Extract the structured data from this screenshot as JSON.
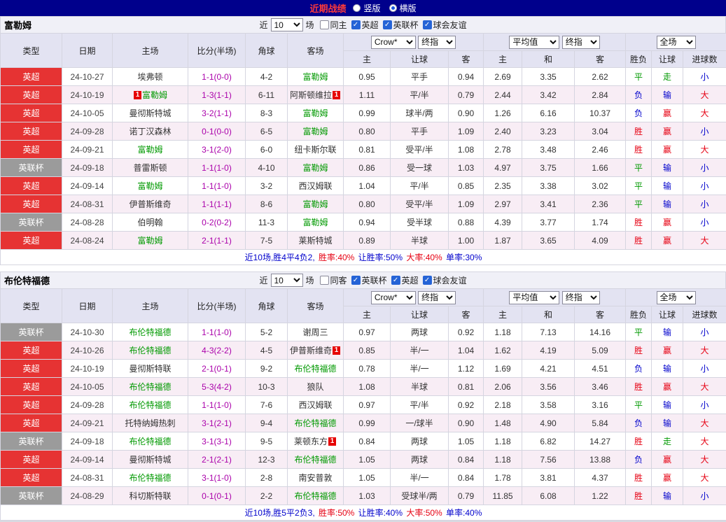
{
  "topbar": {
    "title": "近期战绩",
    "vertical": "竖版",
    "horizontal": "横版"
  },
  "controls": {
    "near": "近",
    "count": "10",
    "games": "场",
    "crow": "Crow*",
    "final": "终指",
    "avg": "平均值",
    "scope": "全场"
  },
  "columns": {
    "main": [
      "类型",
      "日期",
      "主场",
      "比分(半场)",
      "角球",
      "客场"
    ],
    "sub": [
      "主",
      "让球",
      "客",
      "主",
      "和",
      "客",
      "胜负",
      "让球",
      "进球数"
    ]
  },
  "colors": {
    "red": "#e60012",
    "blue": "#0000cc"
  },
  "type_colors": {
    "英超": "#e63333",
    "英联杯": "#9b9b9b"
  },
  "result_colors": {
    "胜": "#e60012",
    "赢": "#e60012",
    "大": "#e60012",
    "平": "#009900",
    "走": "#009900",
    "负": "#0000cc",
    "输": "#0000cc",
    "小": "#0000cc"
  },
  "sections": [
    {
      "team": "富勒姆",
      "filters": [
        {
          "label": "同主",
          "checked": false
        },
        {
          "label": "英超",
          "checked": true
        },
        {
          "label": "英联杯",
          "checked": true
        },
        {
          "label": "球会友谊",
          "checked": true
        }
      ],
      "rows": [
        {
          "type": "英超",
          "date": "24-10-27",
          "home": "埃弗顿",
          "hf": false,
          "hb": "",
          "score": "1-1(0-0)",
          "corner": "4-2",
          "away": "富勒姆",
          "af": true,
          "ab": "",
          "asia": [
            "0.95",
            "平手",
            "0.94"
          ],
          "euro": [
            "2.69",
            "3.35",
            "2.62"
          ],
          "res": [
            "平",
            "走",
            "小"
          ]
        },
        {
          "type": "英超",
          "date": "24-10-19",
          "home": "富勒姆",
          "hf": true,
          "hb": "1",
          "score": "1-3(1-1)",
          "corner": "6-11",
          "away": "阿斯顿维拉",
          "af": false,
          "ab": "1",
          "asia": [
            "1.11",
            "平/半",
            "0.79"
          ],
          "euro": [
            "2.44",
            "3.42",
            "2.84"
          ],
          "res": [
            "负",
            "输",
            "大"
          ]
        },
        {
          "type": "英超",
          "date": "24-10-05",
          "home": "曼彻斯特城",
          "hf": false,
          "hb": "",
          "score": "3-2(1-1)",
          "corner": "8-3",
          "away": "富勒姆",
          "af": true,
          "ab": "",
          "asia": [
            "0.99",
            "球半/两",
            "0.90"
          ],
          "euro": [
            "1.26",
            "6.16",
            "10.37"
          ],
          "res": [
            "负",
            "赢",
            "大"
          ]
        },
        {
          "type": "英超",
          "date": "24-09-28",
          "home": "诺丁汉森林",
          "hf": false,
          "hb": "",
          "score": "0-1(0-0)",
          "corner": "6-5",
          "away": "富勒姆",
          "af": true,
          "ab": "",
          "asia": [
            "0.80",
            "平手",
            "1.09"
          ],
          "euro": [
            "2.40",
            "3.23",
            "3.04"
          ],
          "res": [
            "胜",
            "赢",
            "小"
          ]
        },
        {
          "type": "英超",
          "date": "24-09-21",
          "home": "富勒姆",
          "hf": true,
          "hb": "",
          "score": "3-1(2-0)",
          "corner": "6-0",
          "away": "纽卡斯尔联",
          "af": false,
          "ab": "",
          "asia": [
            "0.81",
            "受平/半",
            "1.08"
          ],
          "euro": [
            "2.78",
            "3.48",
            "2.46"
          ],
          "res": [
            "胜",
            "赢",
            "大"
          ]
        },
        {
          "type": "英联杯",
          "date": "24-09-18",
          "home": "普雷斯顿",
          "hf": false,
          "hb": "",
          "score": "1-1(1-0)",
          "corner": "4-10",
          "away": "富勒姆",
          "af": true,
          "ab": "",
          "asia": [
            "0.86",
            "受一球",
            "1.03"
          ],
          "euro": [
            "4.97",
            "3.75",
            "1.66"
          ],
          "res": [
            "平",
            "输",
            "小"
          ]
        },
        {
          "type": "英超",
          "date": "24-09-14",
          "home": "富勒姆",
          "hf": true,
          "hb": "",
          "score": "1-1(1-0)",
          "corner": "3-2",
          "away": "西汉姆联",
          "af": false,
          "ab": "",
          "asia": [
            "1.04",
            "平/半",
            "0.85"
          ],
          "euro": [
            "2.35",
            "3.38",
            "3.02"
          ],
          "res": [
            "平",
            "输",
            "小"
          ]
        },
        {
          "type": "英超",
          "date": "24-08-31",
          "home": "伊普斯维奇",
          "hf": false,
          "hb": "",
          "score": "1-1(1-1)",
          "corner": "8-6",
          "away": "富勒姆",
          "af": true,
          "ab": "",
          "asia": [
            "0.80",
            "受平/半",
            "1.09"
          ],
          "euro": [
            "2.97",
            "3.41",
            "2.36"
          ],
          "res": [
            "平",
            "输",
            "小"
          ]
        },
        {
          "type": "英联杯",
          "date": "24-08-28",
          "home": "伯明翰",
          "hf": false,
          "hb": "",
          "score": "0-2(0-2)",
          "corner": "11-3",
          "away": "富勒姆",
          "af": true,
          "ab": "",
          "asia": [
            "0.94",
            "受半球",
            "0.88"
          ],
          "euro": [
            "4.39",
            "3.77",
            "1.74"
          ],
          "res": [
            "胜",
            "赢",
            "小"
          ]
        },
        {
          "type": "英超",
          "date": "24-08-24",
          "home": "富勒姆",
          "hf": true,
          "hb": "",
          "score": "2-1(1-1)",
          "corner": "7-5",
          "away": "莱斯特城",
          "af": false,
          "ab": "",
          "asia": [
            "0.89",
            "半球",
            "1.00"
          ],
          "euro": [
            "1.87",
            "3.65",
            "4.09"
          ],
          "res": [
            "胜",
            "赢",
            "大"
          ]
        }
      ],
      "summary": [
        {
          "t": "近10场,胜4平4负2, ",
          "c": "b"
        },
        {
          "t": "胜率:40%",
          "c": "r"
        },
        {
          "t": " 让胜率:50%",
          "c": "b"
        },
        {
          "t": " 大率:40%",
          "c": "r"
        },
        {
          "t": " 单率:30%",
          "c": "b"
        }
      ]
    },
    {
      "team": "布伦特福德",
      "filters": [
        {
          "label": "同客",
          "checked": false
        },
        {
          "label": "英联杯",
          "checked": true
        },
        {
          "label": "英超",
          "checked": true
        },
        {
          "label": "球会友谊",
          "checked": true
        }
      ],
      "rows": [
        {
          "type": "英联杯",
          "date": "24-10-30",
          "home": "布伦特福德",
          "hf": true,
          "hb": "",
          "score": "1-1(1-0)",
          "corner": "5-2",
          "away": "谢周三",
          "af": false,
          "ab": "",
          "asia": [
            "0.97",
            "两球",
            "0.92"
          ],
          "euro": [
            "1.18",
            "7.13",
            "14.16"
          ],
          "res": [
            "平",
            "输",
            "小"
          ]
        },
        {
          "type": "英超",
          "date": "24-10-26",
          "home": "布伦特福德",
          "hf": true,
          "hb": "",
          "score": "4-3(2-2)",
          "corner": "4-5",
          "away": "伊普斯维奇",
          "af": false,
          "ab": "1",
          "asia": [
            "0.85",
            "半/一",
            "1.04"
          ],
          "euro": [
            "1.62",
            "4.19",
            "5.09"
          ],
          "res": [
            "胜",
            "赢",
            "大"
          ]
        },
        {
          "type": "英超",
          "date": "24-10-19",
          "home": "曼彻斯特联",
          "hf": false,
          "hb": "",
          "score": "2-1(0-1)",
          "corner": "9-2",
          "away": "布伦特福德",
          "af": true,
          "ab": "",
          "asia": [
            "0.78",
            "半/一",
            "1.12"
          ],
          "euro": [
            "1.69",
            "4.21",
            "4.51"
          ],
          "res": [
            "负",
            "输",
            "小"
          ]
        },
        {
          "type": "英超",
          "date": "24-10-05",
          "home": "布伦特福德",
          "hf": true,
          "hb": "",
          "score": "5-3(4-2)",
          "corner": "10-3",
          "away": "狼队",
          "af": false,
          "ab": "",
          "asia": [
            "1.08",
            "半球",
            "0.81"
          ],
          "euro": [
            "2.06",
            "3.56",
            "3.46"
          ],
          "res": [
            "胜",
            "赢",
            "大"
          ]
        },
        {
          "type": "英超",
          "date": "24-09-28",
          "home": "布伦特福德",
          "hf": true,
          "hb": "",
          "score": "1-1(1-0)",
          "corner": "7-6",
          "away": "西汉姆联",
          "af": false,
          "ab": "",
          "asia": [
            "0.97",
            "平/半",
            "0.92"
          ],
          "euro": [
            "2.18",
            "3.58",
            "3.16"
          ],
          "res": [
            "平",
            "输",
            "小"
          ]
        },
        {
          "type": "英超",
          "date": "24-09-21",
          "home": "托特纳姆热刺",
          "hf": false,
          "hb": "",
          "score": "3-1(2-1)",
          "corner": "9-4",
          "away": "布伦特福德",
          "af": true,
          "ab": "",
          "asia": [
            "0.99",
            "一/球半",
            "0.90"
          ],
          "euro": [
            "1.48",
            "4.90",
            "5.84"
          ],
          "res": [
            "负",
            "输",
            "大"
          ]
        },
        {
          "type": "英联杯",
          "date": "24-09-18",
          "home": "布伦特福德",
          "hf": true,
          "hb": "",
          "score": "3-1(3-1)",
          "corner": "9-5",
          "away": "莱顿东方",
          "af": false,
          "ab": "1",
          "asia": [
            "0.84",
            "两球",
            "1.05"
          ],
          "euro": [
            "1.18",
            "6.82",
            "14.27"
          ],
          "res": [
            "胜",
            "走",
            "大"
          ]
        },
        {
          "type": "英超",
          "date": "24-09-14",
          "home": "曼彻斯特城",
          "hf": false,
          "hb": "",
          "score": "2-1(2-1)",
          "corner": "12-3",
          "away": "布伦特福德",
          "af": true,
          "ab": "",
          "asia": [
            "1.05",
            "两球",
            "0.84"
          ],
          "euro": [
            "1.18",
            "7.56",
            "13.88"
          ],
          "res": [
            "负",
            "赢",
            "大"
          ]
        },
        {
          "type": "英超",
          "date": "24-08-31",
          "home": "布伦特福德",
          "hf": true,
          "hb": "",
          "score": "3-1(1-0)",
          "corner": "2-8",
          "away": "南安普敦",
          "af": false,
          "ab": "",
          "asia": [
            "1.05",
            "半/一",
            "0.84"
          ],
          "euro": [
            "1.78",
            "3.81",
            "4.37"
          ],
          "res": [
            "胜",
            "赢",
            "大"
          ]
        },
        {
          "type": "英联杯",
          "date": "24-08-29",
          "home": "科切斯特联",
          "hf": false,
          "hb": "",
          "score": "0-1(0-1)",
          "corner": "2-2",
          "away": "布伦特福德",
          "af": true,
          "ab": "",
          "asia": [
            "1.03",
            "受球半/两",
            "0.79"
          ],
          "euro": [
            "11.85",
            "6.08",
            "1.22"
          ],
          "res": [
            "胜",
            "输",
            "小"
          ]
        }
      ],
      "summary": [
        {
          "t": "近10场,胜5平2负3, ",
          "c": "b"
        },
        {
          "t": "胜率:50%",
          "c": "r"
        },
        {
          "t": " 让胜率:40%",
          "c": "b"
        },
        {
          "t": " 大率:50%",
          "c": "r"
        },
        {
          "t": " 单率:40%",
          "c": "b"
        }
      ]
    }
  ]
}
